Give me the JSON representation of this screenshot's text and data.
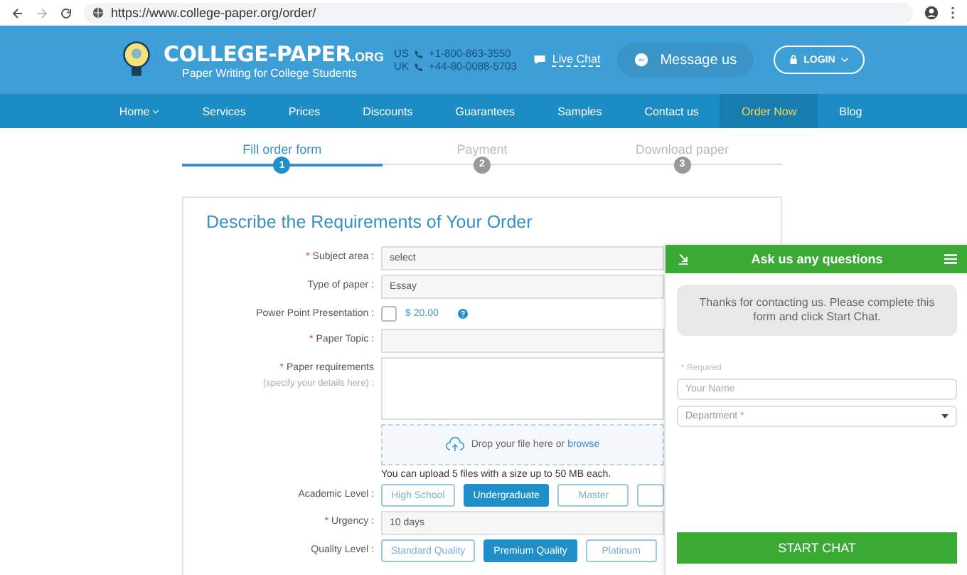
{
  "browser": {
    "url": "https://www.college-paper.org/order/"
  },
  "header": {
    "brand": "COLLEGE-PAPER",
    "brand_suffix": ".ORG",
    "tagline": "Paper Writing for College Students",
    "phones": [
      {
        "country": "US",
        "number": "+1-800-863-3550"
      },
      {
        "country": "UK",
        "number": "+44-80-0088-5703"
      }
    ],
    "live_chat": "Live Chat",
    "message_button": "Message us",
    "login_button": "LOGIN"
  },
  "nav": [
    {
      "label": "Home",
      "selected": false,
      "has_menu": true
    },
    {
      "label": "Services",
      "selected": false,
      "has_menu": false
    },
    {
      "label": "Prices",
      "selected": false,
      "has_menu": false
    },
    {
      "label": "Discounts",
      "selected": false,
      "has_menu": false
    },
    {
      "label": "Guarantees",
      "selected": false,
      "has_menu": false
    },
    {
      "label": "Samples",
      "selected": false,
      "has_menu": false
    },
    {
      "label": "Contact us",
      "selected": false,
      "has_menu": false
    },
    {
      "label": "Order Now",
      "selected": true,
      "has_menu": false
    },
    {
      "label": "Blog",
      "selected": false,
      "has_menu": false
    }
  ],
  "steps": [
    {
      "label": "Fill order form",
      "number": "1",
      "selected": true
    },
    {
      "label": "Payment",
      "number": "2",
      "selected": false
    },
    {
      "label": "Download paper",
      "number": "3",
      "selected": false
    }
  ],
  "form": {
    "title": "Describe the Requirements of Your Order",
    "fields": [
      {
        "kind": "select",
        "label": "Subject area :",
        "required_mark": "*",
        "value": "select"
      },
      {
        "kind": "select",
        "label": "Type of paper :",
        "value": "Essay"
      },
      {
        "kind": "checkbox",
        "label": "Power Point Presentation :",
        "checked": false,
        "price": "$ 20.00"
      },
      {
        "kind": "text",
        "label": "Paper Topic :",
        "required_mark": "*"
      },
      {
        "kind": "textarea",
        "label": "Paper requirements",
        "hint": "(specify your details here) :",
        "required_mark": "*"
      },
      {
        "kind": "upload",
        "text": "Drop your file here or ",
        "link": "browse",
        "note": "You can upload 5 files with a size up to 50 MB each."
      },
      {
        "kind": "options",
        "label": "Academic Level :",
        "options": [
          {
            "label": "High School",
            "selected": false
          },
          {
            "label": "Undergraduate",
            "selected": true
          },
          {
            "label": "Master",
            "selected": false
          }
        ],
        "more": true
      },
      {
        "kind": "select",
        "label": "Urgency :",
        "required_mark": "*",
        "value": "10 days"
      },
      {
        "kind": "options",
        "label": "Quality Level :",
        "options": [
          {
            "label": "Standard Quality",
            "selected": false
          },
          {
            "label": "Premium Quality",
            "selected": true
          },
          {
            "label": "Platinum",
            "selected": false
          }
        ]
      }
    ]
  },
  "chat": {
    "title": "Ask us any questions",
    "message": "Thanks for contacting us. Please complete this form and click Start Chat.",
    "required_note": "* Required",
    "name_placeholder": "Your Name",
    "department_placeholder": "Department *",
    "start_button": "START CHAT"
  }
}
